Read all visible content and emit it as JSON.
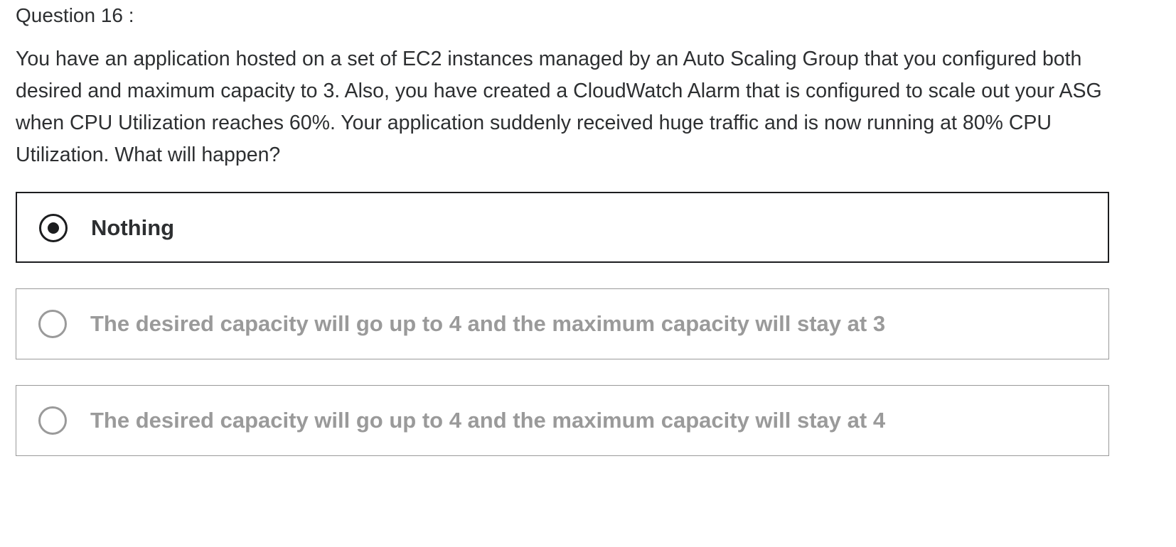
{
  "question": {
    "label": "Question 16 :",
    "text": "You have an application hosted on a set of EC2 instances managed by an Auto Scaling Group that you configured both desired and maximum capacity to 3. Also, you have created a CloudWatch Alarm that is configured to scale out your ASG when CPU Utilization reaches 60%. Your application suddenly received huge traffic and is now running at 80% CPU Utilization. What will happen?"
  },
  "options": [
    {
      "label": "Nothing",
      "selected": true
    },
    {
      "label": "The desired capacity will go up to 4 and the maximum capacity will stay at 3",
      "selected": false
    },
    {
      "label": "The desired capacity will go up to 4 and the maximum capacity will stay at 4",
      "selected": false
    }
  ],
  "colors": {
    "text": "#2d2f31",
    "selected_border": "#1c1d1f",
    "unselected": "#9a9a9a"
  },
  "icons": {
    "selected_radio": "radio-checked-icon",
    "unselected_radio": "radio-unchecked-icon"
  }
}
